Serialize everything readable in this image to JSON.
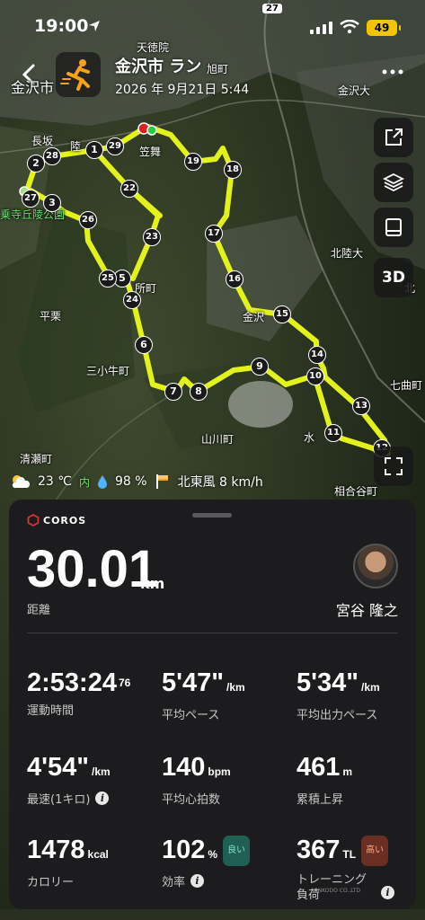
{
  "status_bar": {
    "time": "19:00",
    "battery": "49"
  },
  "header": {
    "title": "金沢市 ラン",
    "datetime": "2026 年 9月21日 5:44",
    "back_label": "金沢市"
  },
  "map": {
    "place_labels": {
      "tentokuin": "天徳院",
      "asahimachi": "旭町",
      "kanazawa_dai": "金沢大",
      "nagasaka": "長坂",
      "hokuriku_dai": "北陸大",
      "heiritsu": "平栗",
      "sankogyu": "三小牛町",
      "yamakawa": "山川町",
      "kiyose": "清瀬町",
      "shichikyoku": "七曲町",
      "aidaya": "相合谷町",
      "kaisho": "所町",
      "kanazawa_mid": "金沢",
      "sunaba": "水",
      "kasamai": "笠舞",
      "hoku": "北",
      "riku": "陸",
      "park": "乗寺丘陵公園",
      "road_no": "27"
    },
    "markers": [
      "1",
      "2",
      "3",
      "5",
      "6",
      "7",
      "8",
      "9",
      "10",
      "11",
      "12",
      "13",
      "14",
      "15",
      "16",
      "17",
      "18",
      "19",
      "22",
      "23",
      "24",
      "25",
      "26",
      "27",
      "28",
      "29"
    ],
    "buttons": {
      "three_d": "3D"
    }
  },
  "weather": {
    "temperature": "23 ℃",
    "humidity": "98 %",
    "humidity_prefix": "内",
    "wind": "北東風 8 km/h"
  },
  "panel": {
    "brand": "COROS",
    "distance": "30.01",
    "distance_unit": "km",
    "distance_label": "距離",
    "user_name": "宮谷 隆之",
    "stats": {
      "moving_time": {
        "value": "2:53:24",
        "sup": "76",
        "label": "運動時間"
      },
      "avg_pace": {
        "value": "5'47\"",
        "unit": "/km",
        "label": "平均ペース"
      },
      "avg_power_pace": {
        "value": "5'34\"",
        "unit": "/km",
        "label": "平均出力ペース"
      },
      "fastest": {
        "value": "4'54\"",
        "unit": "/km",
        "label": "最速(1キロ)"
      },
      "avg_hr": {
        "value": "140",
        "unit": "bpm",
        "label": "平均心拍数"
      },
      "elevation": {
        "value": "461",
        "unit": "m",
        "label": "累積上昇"
      },
      "calories": {
        "value": "1478",
        "unit": "kcal",
        "label": "カロリー"
      },
      "efficiency": {
        "value": "102",
        "unit": "%",
        "badge": "良い",
        "label": "効率"
      },
      "training_load": {
        "value": "367",
        "unit": "TL",
        "badge": "高い",
        "label": "トレーニング",
        "label2": "負荷"
      }
    },
    "footer_brand": "KINKODO CO.,LTD"
  },
  "colors": {
    "route": "#e2f21a",
    "accent_yellow": "#f2c500",
    "good": "#7fe3c8",
    "high": "#ffa78a"
  }
}
